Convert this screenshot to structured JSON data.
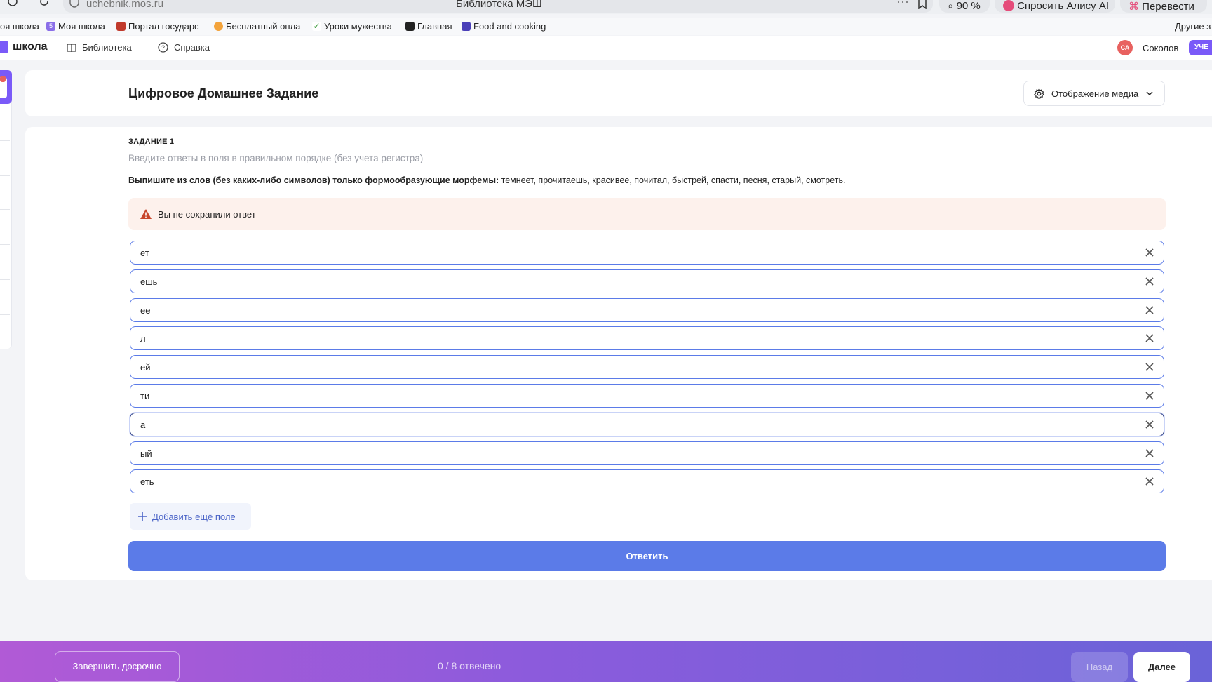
{
  "browser": {
    "url": "uchebnik.mos.ru",
    "page_title": "Библиотека МЭШ",
    "zoom": "90 %",
    "alice_label": "Спросить Алису AI",
    "translate_label": "Перевести"
  },
  "bookmarks": [
    {
      "label": "оя школа"
    },
    {
      "label": "Моя школа",
      "icon_text": "5"
    },
    {
      "label": "Портал государс"
    },
    {
      "label": "Бесплатный онла"
    },
    {
      "label": "Уроки мужества"
    },
    {
      "label": "Главная"
    },
    {
      "label": "Food and cooking"
    },
    {
      "label": "Другие з"
    }
  ],
  "header": {
    "logo": "школа",
    "nav": [
      {
        "label": "Библиотека"
      },
      {
        "label": "Справка"
      }
    ],
    "avatar_initials": "СА",
    "user_name": "Соколов",
    "role": "УЧЕ"
  },
  "page": {
    "title": "Цифровое Домашнее Задание",
    "media_button": "Отображение медиа"
  },
  "task": {
    "label": "ЗАДАНИЕ 1",
    "hint": "Введите ответы в поля в правильном порядке (без учета регистра)",
    "instruction_bold": "Выпишите из слов (без каких-либо символов) только формообразующие морфемы:",
    "instruction_words": " темнеет, прочитаешь, красивее, почитал, быстрей, спасти, песня, старый, смотреть.",
    "warning": "Вы не сохранили ответ",
    "fields": [
      "ет",
      "ешь",
      "ее",
      "л",
      "ей",
      "ти",
      "а",
      "ый",
      "еть"
    ],
    "focused_index": 6,
    "add_field_label": "Добавить ещё поле",
    "answer_label": "Ответить"
  },
  "footer": {
    "finish_label": "Завершить досрочно",
    "progress": "0 / 8 отвечено",
    "answered": 0,
    "total": 8,
    "back_label": "Назад",
    "next_label": "Далее"
  },
  "colors": {
    "accent": "#5b7be8",
    "brand": "#7a5af8",
    "warning_bg": "#fdf1ec",
    "warning_icon": "#c8462b"
  }
}
